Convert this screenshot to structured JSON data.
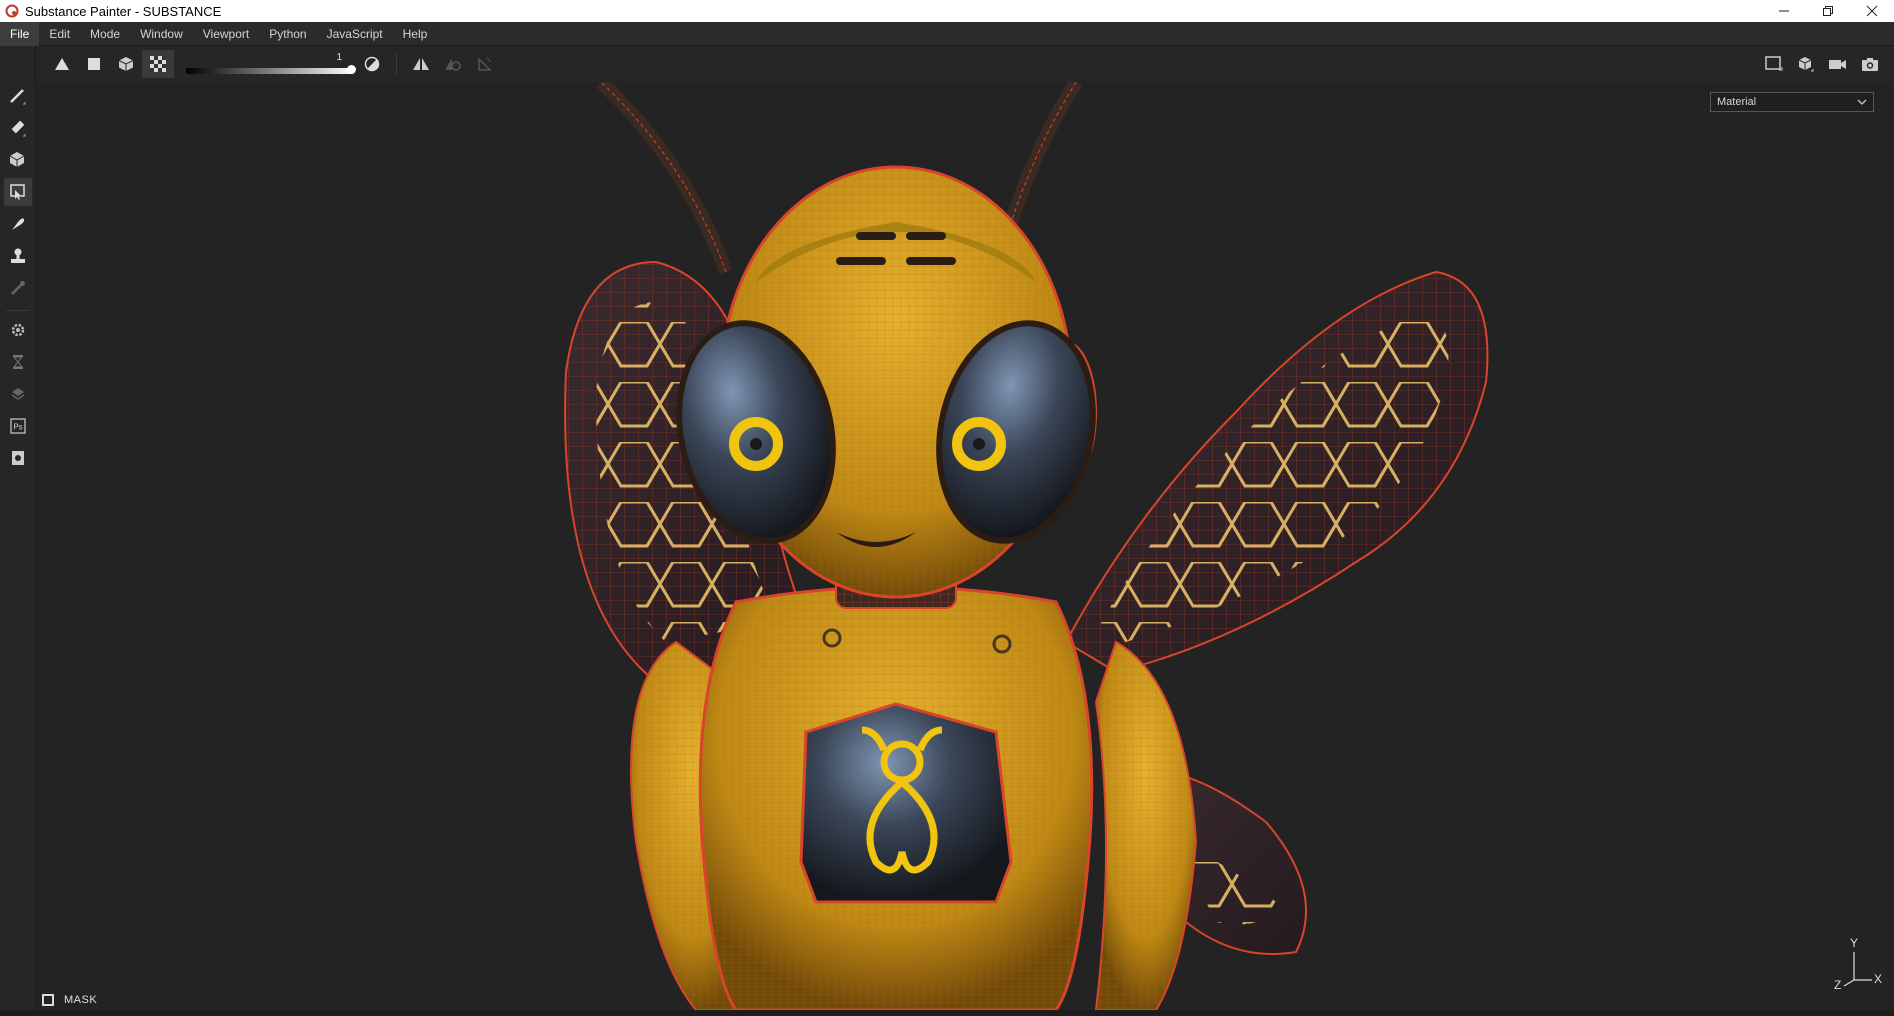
{
  "window": {
    "title": "Substance Painter - SUBSTANCE",
    "controls": [
      "minimize",
      "restore",
      "close"
    ]
  },
  "menu": {
    "items": [
      {
        "label": "File",
        "active": true
      },
      {
        "label": "Edit"
      },
      {
        "label": "Mode"
      },
      {
        "label": "Window"
      },
      {
        "label": "Viewport"
      },
      {
        "label": "Python"
      },
      {
        "label": "JavaScript"
      },
      {
        "label": "Help"
      }
    ]
  },
  "toolbar": {
    "left_buttons": [
      "triangle-icon",
      "square-icon",
      "cube-icon",
      "checker-icon"
    ],
    "selected": "checker-icon",
    "slider": {
      "value": "1",
      "level": 1.0
    },
    "after_slider": [
      "contrast-icon"
    ],
    "symmetry": [
      "mirror-icon",
      "mirror-off-icon",
      "transform-icon"
    ],
    "right_buttons": [
      "viewport-frame-icon",
      "cube-view-icon",
      "camera-icon",
      "screenshot-icon"
    ]
  },
  "left_tools": {
    "items": [
      "brush-icon",
      "eraser-icon",
      "projection-icon",
      "polygon-fill-icon",
      "smudge-icon",
      "clone-icon",
      "color-picker-icon",
      "settings-icon",
      "bake-icon",
      "layers-icon",
      "photoshop-icon",
      "export-icon"
    ],
    "selected": "polygon-fill-icon"
  },
  "viewport": {
    "channel": "Material",
    "mask_label": "MASK",
    "gizmo": {
      "y": "Y",
      "z": "Z",
      "x": "X"
    }
  },
  "colors": {
    "body_yellow": "#c9a018",
    "wire_red": "#d8452a",
    "eye_yellow": "#f1c40f",
    "background": "#232323"
  }
}
